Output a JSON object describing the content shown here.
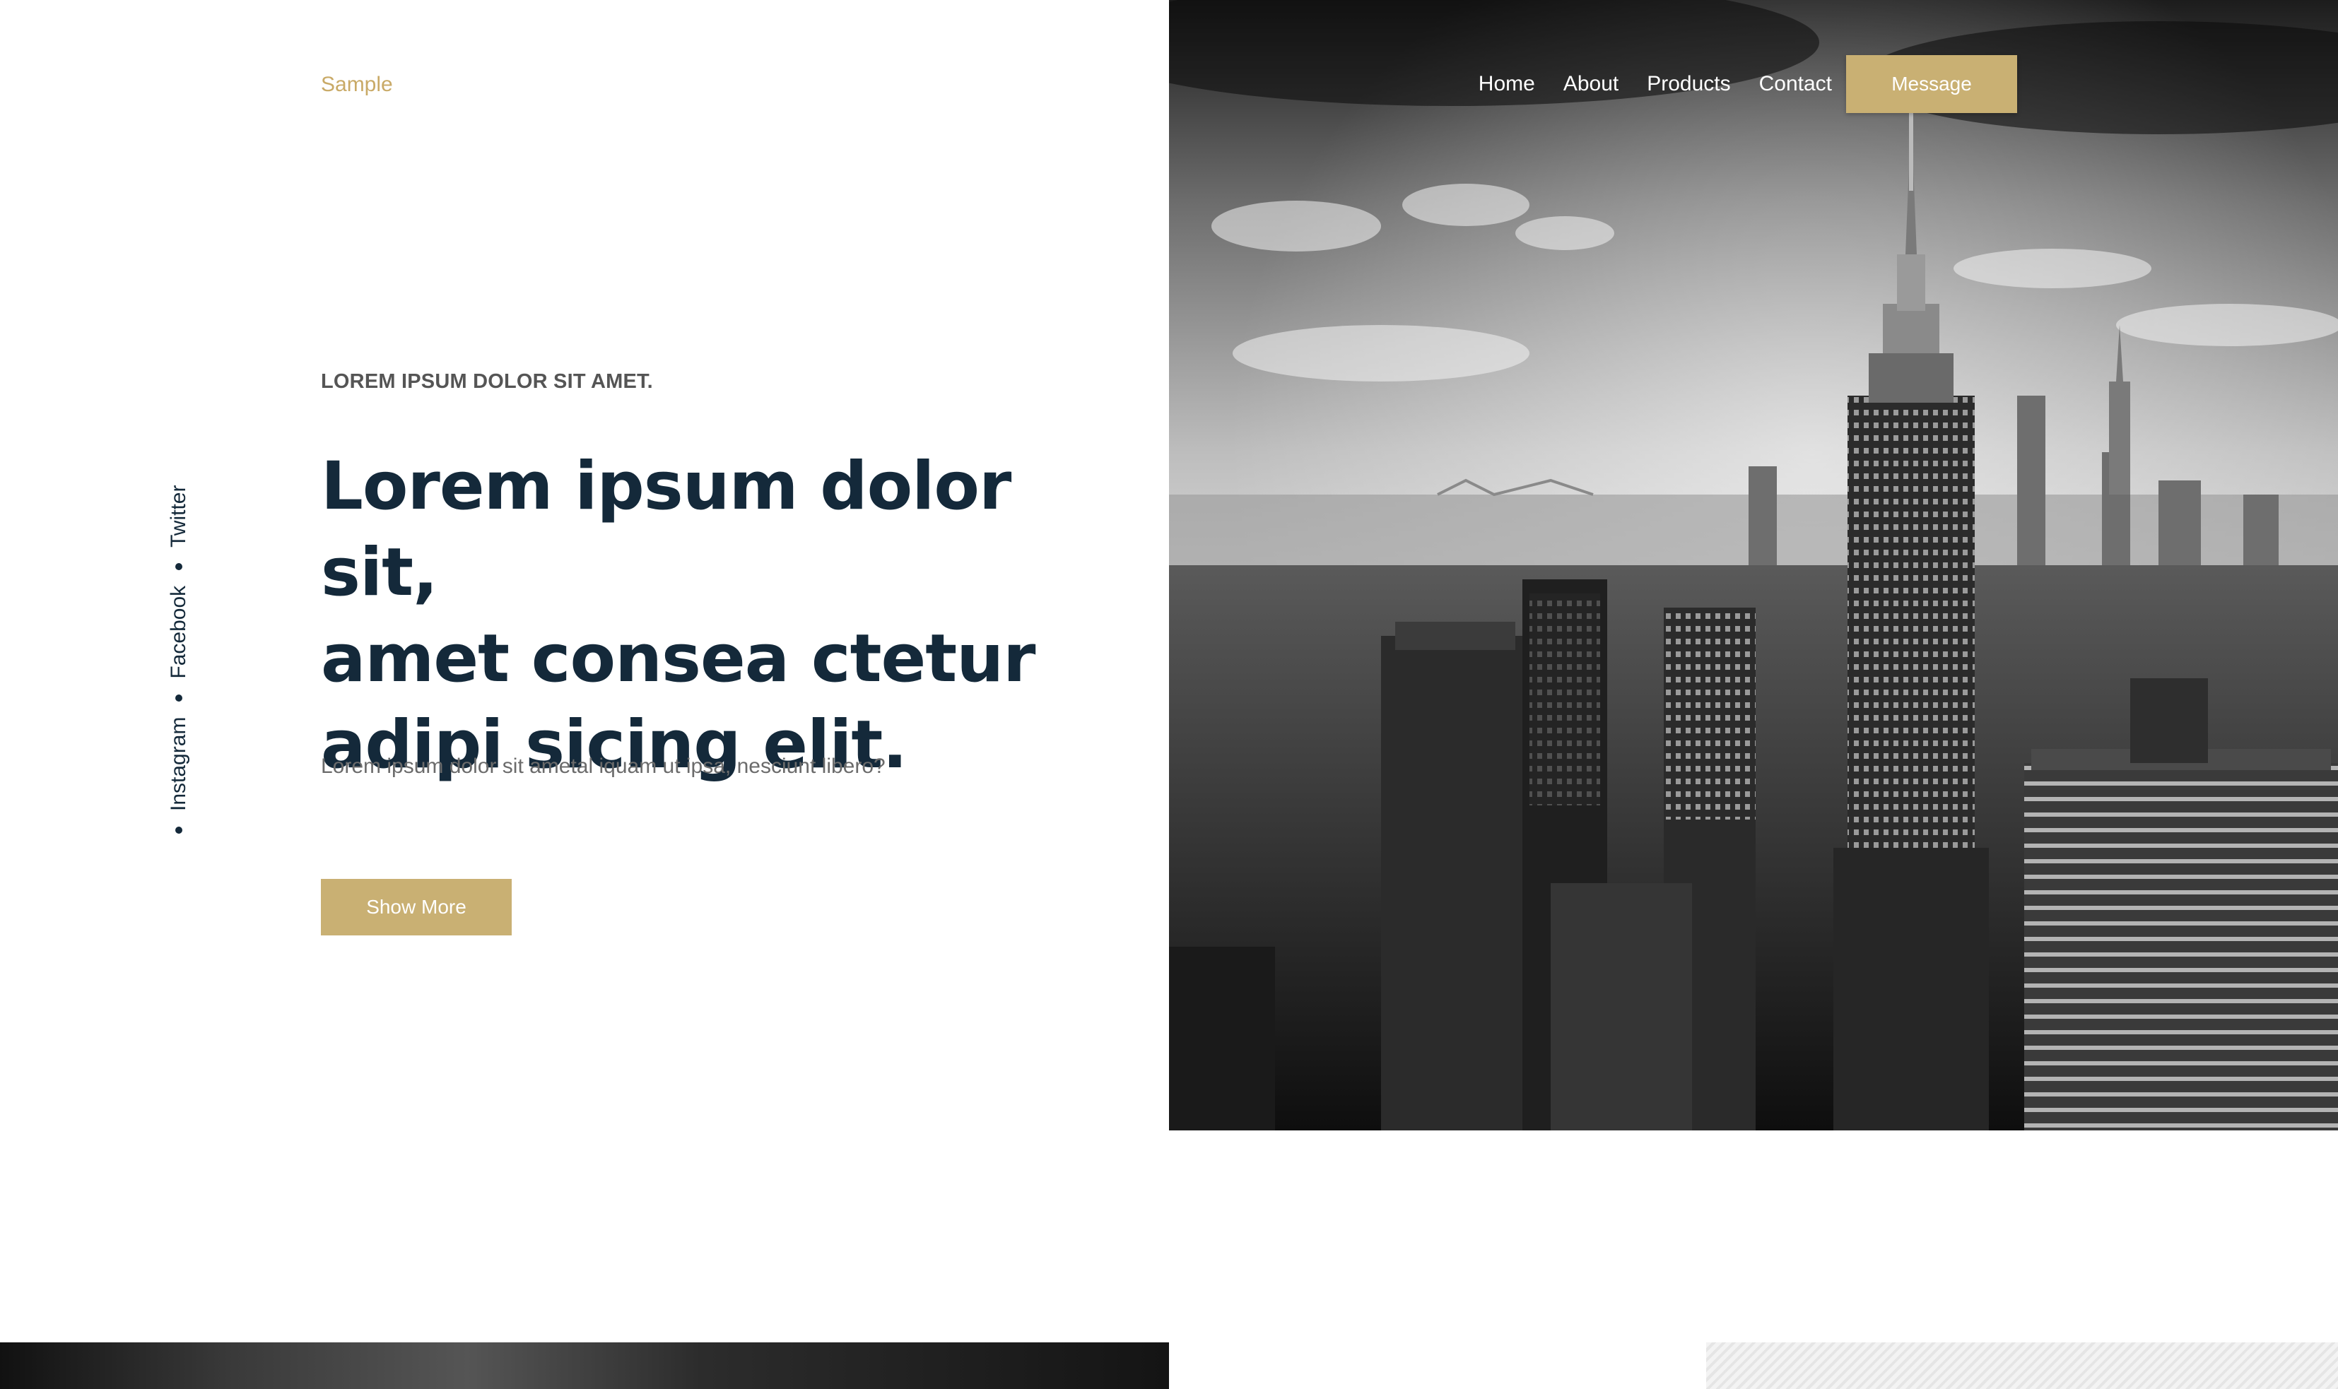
{
  "brand": {
    "name": "Sample",
    "color": "#c9aa67"
  },
  "nav": {
    "items": [
      {
        "label": "Home"
      },
      {
        "label": "About"
      },
      {
        "label": "Products"
      },
      {
        "label": "Contact"
      }
    ],
    "cta_label": "Message"
  },
  "social": {
    "items": [
      {
        "label": "Instagram"
      },
      {
        "label": "Facebook"
      },
      {
        "label": "Twitter"
      }
    ]
  },
  "hero": {
    "eyebrow": "LOREM IPSUM DOLOR SIT AMET.",
    "headline_lines": [
      "Lorem ipsum dolor sit,",
      "amet consea ctetur",
      "adipi sicing elit."
    ],
    "lead": "Lorem ipsum dolor sit ametal iquam ut ipsa, nesciunt libero?",
    "button_label": "Show More",
    "accent_color": "#c9b073",
    "heading_color": "#14293a"
  }
}
